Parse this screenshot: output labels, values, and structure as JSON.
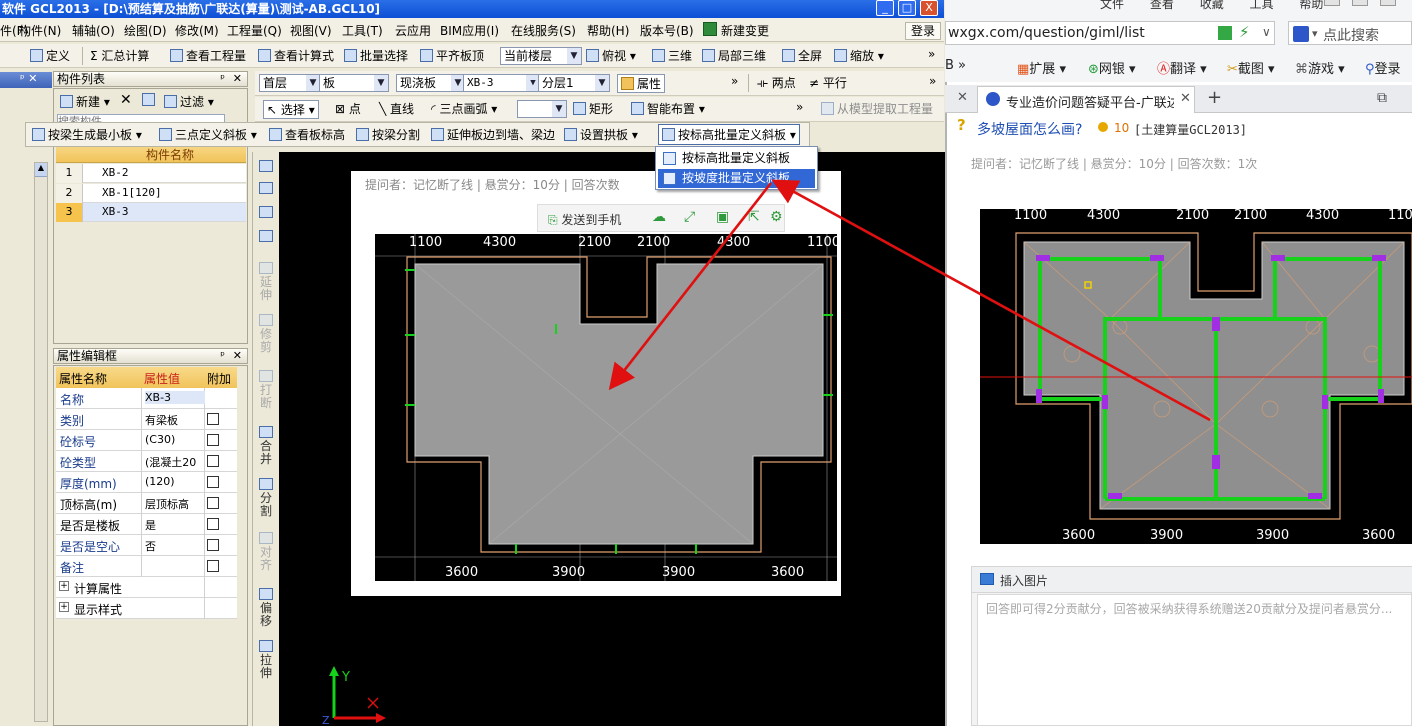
{
  "app": {
    "title": "软件 GCL2013 - [D:\\预结算及抽筋\\广联达(算量)\\测试-AB.GCL10]",
    "window_buttons": [
      "_",
      "□",
      "X"
    ]
  },
  "menubar": {
    "items": [
      "件(F)",
      "构件(N)",
      "辅轴(O)",
      "绘图(D)",
      "修改(M)",
      "工程量(Q)",
      "视图(V)",
      "工具(T)",
      "云应用",
      "BIM应用(I)",
      "在线服务(S)",
      "帮助(H)",
      "版本号(B)",
      "新建变更"
    ],
    "login": "登录"
  },
  "toolbar1": {
    "items": [
      "定义",
      "Σ 汇总计算",
      "查看工程量",
      "查看计算式",
      "批量选择",
      "平齐板顶"
    ],
    "floor_combo": "当前楼层",
    "view_items": [
      "俯视",
      "三维",
      "局部三维",
      "全屏",
      "缩放"
    ],
    "more": "»"
  },
  "panel_component_list": {
    "title": "构件列表",
    "new_label": "新建",
    "filter_label": "过滤",
    "search_placeholder": "搜索构件...",
    "column_header": "构件名称",
    "rows": [
      {
        "num": "1",
        "name": "XB-2"
      },
      {
        "num": "2",
        "name": "XB-1[120]"
      },
      {
        "num": "3",
        "name": "XB-3"
      }
    ]
  },
  "panel_properties": {
    "title": "属性编辑框",
    "headers": [
      "属性名称",
      "属性值",
      "附加"
    ],
    "rows": [
      {
        "name": "名称",
        "value": "XB-3"
      },
      {
        "name": "类别",
        "value": "有梁板"
      },
      {
        "name": "砼标号",
        "value": "(C30)"
      },
      {
        "name": "砼类型",
        "value": "(混凝土20"
      },
      {
        "name": "厚度(mm)",
        "value": "(120)"
      },
      {
        "name": "顶标高(m)",
        "value": "层顶标高"
      },
      {
        "name": "是否是楼板",
        "value": "是"
      },
      {
        "name": "是否是空心",
        "value": "否"
      },
      {
        "name": "备注",
        "value": ""
      }
    ],
    "groups": [
      "计算属性",
      "显示样式"
    ]
  },
  "filter_bar": {
    "floor": "首层",
    "type": "板",
    "subtype": "现浇板",
    "component": "XB-3",
    "layer": "分层1",
    "props_button": "属性",
    "more": "»",
    "right_items": [
      "两点",
      "平行"
    ]
  },
  "draw_bar": {
    "items": [
      "选择",
      "点",
      "直线",
      "三点画弧",
      "矩形",
      "智能布置"
    ],
    "more": "»",
    "extract": "从模型提取工程量"
  },
  "slope_bar": {
    "items": [
      "按梁生成最小板",
      "三点定义斜板",
      "查看板标高",
      "按梁分割",
      "延伸板边到墙、梁边",
      "设置拱板",
      "按标高批量定义斜板"
    ]
  },
  "dropdown": {
    "items": [
      "按标高批量定义斜板",
      "按坡度批量定义斜板"
    ]
  },
  "vertical_toolbar": {
    "items": [
      "延伸",
      "修剪",
      "打断",
      "合并",
      "分割",
      "对齐",
      "偏移",
      "拉伸"
    ]
  },
  "embedded_card": {
    "meta": "提问者：记忆断了线 | 悬赏分：10分 | 回答次数",
    "send_to_phone": "发送到手机",
    "dims_top": [
      "1100",
      "4300",
      "2100",
      "2100",
      "4300",
      "1100"
    ],
    "dims_bottom": [
      "3600",
      "3900",
      "3900",
      "3600"
    ]
  },
  "axis": {
    "y": "Y",
    "x": "X"
  },
  "browser": {
    "top_menu": [
      "文件",
      "查看",
      "收藏",
      "工具",
      "帮助"
    ],
    "address": "wxgx.com/question/giml/list",
    "search_placeholder": "点此搜索",
    "toolbar": [
      "扩展",
      "网银",
      "翻译",
      "截图",
      "游戏",
      "登录"
    ],
    "tab_title": "专业造价问题答疑平台-广联达",
    "question_title": "多坡屋面怎么画?",
    "reward": "10",
    "tag": "[土建算量GCL2013]",
    "meta": "提问者：记忆断了线 | 悬赏分：10分 | 回答次数：1次",
    "dims_top": [
      "1100",
      "4300",
      "2100",
      "2100",
      "4300",
      "1100"
    ],
    "dims_bottom": [
      "3600",
      "3900",
      "3900",
      "3600"
    ],
    "insert_image": "插入图片",
    "answer_placeholder": "回答即可得2分贡献分，回答被采纳获得系统赠送20贡献分及提问者悬赏分..."
  },
  "colors": {
    "accent": "#3168d5",
    "annotation_arrow": "#e01010",
    "slab_fill": "#9a9a9a",
    "beam_green": "#19d21c",
    "column_purple": "#9a2ce0"
  }
}
